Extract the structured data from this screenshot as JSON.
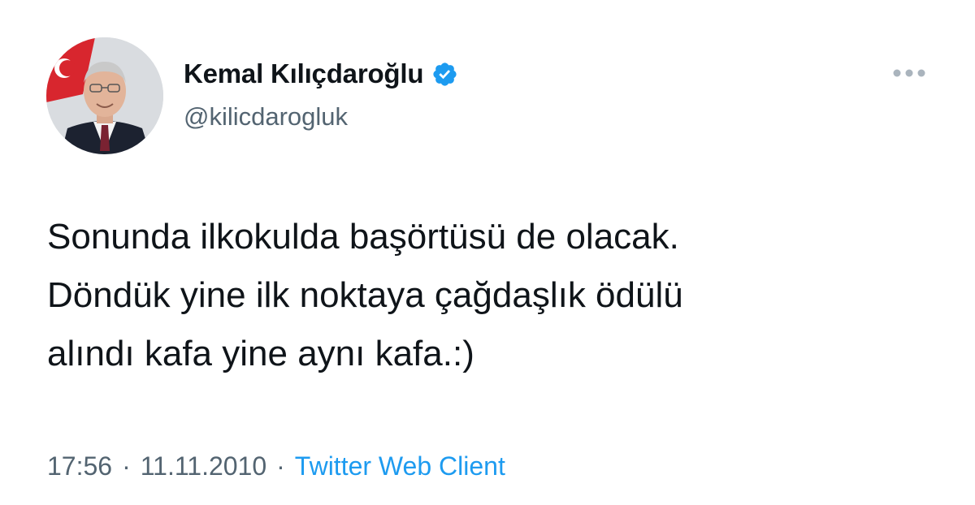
{
  "author": {
    "display_name": "Kemal Kılıçdaroğlu",
    "handle": "@kilicdarogluk",
    "verified_icon": "verified-badge-icon",
    "avatar_icon": "profile-photo"
  },
  "tweet": {
    "lines": [
      "Sonunda ilkokulda başörtüsü de olacak.",
      "Döndük yine ilk noktaya çağdaşlık ödülü",
      "alındı kafa yine aynı kafa.:)"
    ],
    "time": "17:56",
    "date": "11.11.2010",
    "separator": "·",
    "source": "Twitter Web Client"
  },
  "more_icon": "more-horizontal-icon",
  "colors": {
    "text": "#0f1419",
    "secondary": "#536471",
    "accent": "#1d9bf0"
  }
}
